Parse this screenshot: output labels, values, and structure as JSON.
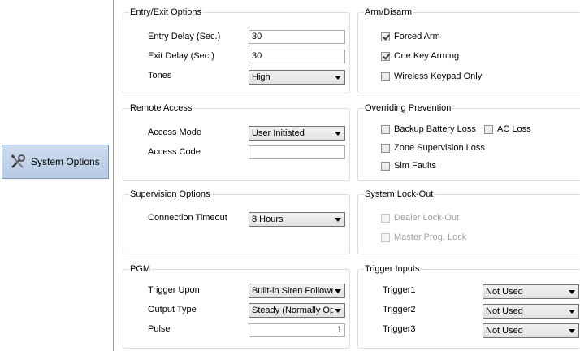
{
  "nav": {
    "system_options": "System Options"
  },
  "entry_exit": {
    "title": "Entry/Exit Options",
    "entry_delay_label": "Entry Delay (Sec.)",
    "entry_delay_value": "30",
    "exit_delay_label": "Exit Delay (Sec.)",
    "exit_delay_value": "30",
    "tones_label": "Tones",
    "tones_value": "High"
  },
  "arm_disarm": {
    "title": "Arm/Disarm",
    "forced_arm": "Forced Arm",
    "forced_arm_checked": true,
    "one_key_arming": "One Key Arming",
    "one_key_arming_checked": true,
    "wireless_keypad_only": "Wireless Keypad Only",
    "wireless_keypad_only_checked": false
  },
  "remote_access": {
    "title": "Remote Access",
    "access_mode_label": "Access Mode",
    "access_mode_value": "User Initiated",
    "access_code_label": "Access Code",
    "access_code_value": ""
  },
  "overriding_prevention": {
    "title": "Overriding Prevention",
    "backup_battery_loss": "Backup Battery Loss",
    "ac_loss": "AC Loss",
    "zone_supervision_loss": "Zone Supervision Loss",
    "sim_faults": "Sim Faults"
  },
  "supervision": {
    "title": "Supervision Options",
    "connection_timeout_label": "Connection Timeout",
    "connection_timeout_value": "8 Hours"
  },
  "lockout": {
    "title": "System Lock-Out",
    "dealer_lockout": "Dealer Lock-Out",
    "master_prog_lock": "Master Prog. Lock"
  },
  "pgm": {
    "title": "PGM",
    "trigger_upon_label": "Trigger Upon",
    "trigger_upon_value": "Built-in Siren Follower",
    "output_type_label": "Output Type",
    "output_type_value": "Steady (Normally Open)",
    "pulse_label": "Pulse",
    "pulse_value": "1"
  },
  "trigger_inputs": {
    "title": "Trigger Inputs",
    "trigger1_label": "Trigger1",
    "trigger1_value": "Not Used",
    "trigger2_label": "Trigger2",
    "trigger2_value": "Not Used",
    "trigger3_label": "Trigger3",
    "trigger3_value": "Not Used"
  }
}
